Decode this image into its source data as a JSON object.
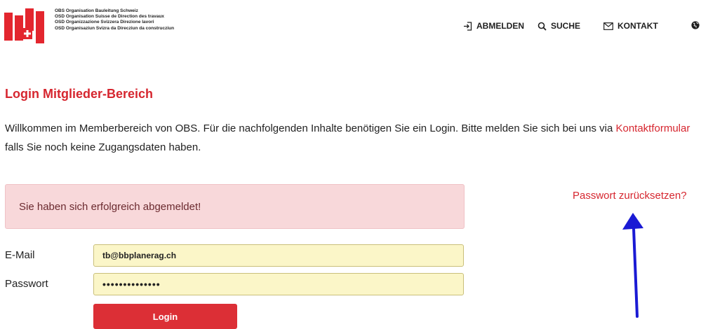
{
  "header": {
    "org_names": [
      "OBS Organisation Bauleitung Schweiz",
      "OSD Organisation Suisse de Direction des travaux",
      "OSD Organizzazione Svizzera Direzione lavori",
      "OSD Organisaziun Svizra da Direcziun da construcziun"
    ],
    "nav": {
      "logout_label": "ABMELDEN",
      "search_label": "SUCHE",
      "contact_label": "KONTAKT"
    }
  },
  "main": {
    "title": "Login Mitglieder-Bereich",
    "intro_before": "Willkommen im Memberbereich von OBS. Für die nachfolgenden Inhalte benötigen Sie ein Login. Bitte melden Sie sich bei uns via ",
    "intro_link": "Kontaktformular",
    "intro_after": " falls Sie noch keine Zugangsdaten haben.",
    "alert_message": "Sie haben sich erfolgreich abgemeldet!",
    "reset_password_link": "Passwort zurücksetzen?"
  },
  "form": {
    "email_label": "E-Mail",
    "email_value": "tb@bbplanerag.ch",
    "password_label": "Passwort",
    "password_value": "••••••••••••••",
    "login_button": "Login"
  },
  "colors": {
    "brand_red": "#d6262f",
    "button_red": "#dc2f36",
    "alert_background": "#f8d8da",
    "input_background": "#fbf6c8",
    "annotation_arrow": "#1a1ad4"
  },
  "icons": {
    "logo": "swiss-cross-logo",
    "logout": "logout-icon",
    "search": "search-icon",
    "contact": "envelope-icon",
    "language": "globe-icon"
  }
}
